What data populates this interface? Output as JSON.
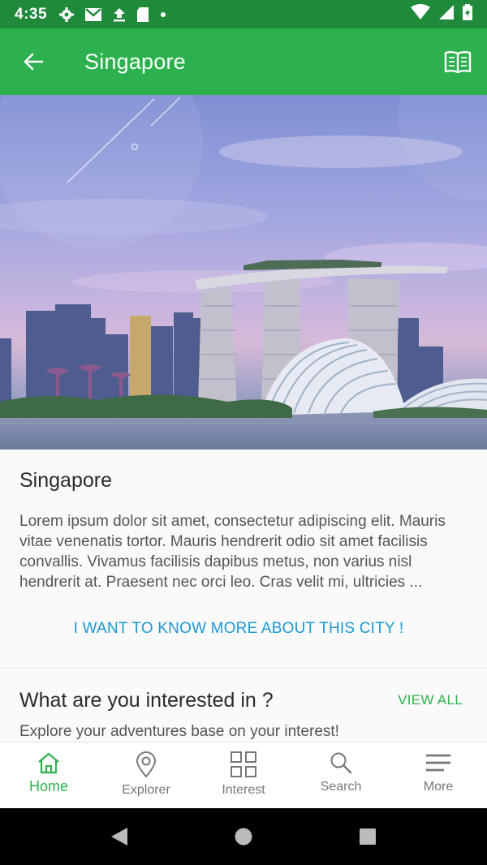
{
  "status_bar": {
    "time": "4:35"
  },
  "app_bar": {
    "title": "Singapore"
  },
  "intro": {
    "heading": "Singapore",
    "body": "Lorem ipsum dolor sit amet, consectetur adipiscing elit. Mauris vitae venenatis tortor. Mauris hendrerit odio sit amet facilisis convallis. Vivamus facilisis dapibus metus, non varius nisl hendrerit at. Praesent nec orci leo. Cras velit mi, ultricies ...",
    "cta": "I WANT TO KNOW MORE ABOUT THIS CITY !"
  },
  "interest": {
    "heading": "What are you interested in ?",
    "view_all": "VIEW ALL",
    "subtitle": "Explore your adventures base on your interest!"
  },
  "bottom_nav": {
    "items": [
      {
        "label": "Home",
        "icon": "home-icon",
        "active": true
      },
      {
        "label": "Explorer",
        "icon": "location-pin-icon",
        "active": false
      },
      {
        "label": "Interest",
        "icon": "grid-icon",
        "active": false
      },
      {
        "label": "Search",
        "icon": "search-icon",
        "active": false
      },
      {
        "label": "More",
        "icon": "menu-icon",
        "active": false
      }
    ]
  },
  "colors": {
    "status_bar": "#1e8a3a",
    "app_bar": "#2db14f",
    "accent_green": "#2db14f",
    "link_blue": "#1a98d5"
  }
}
